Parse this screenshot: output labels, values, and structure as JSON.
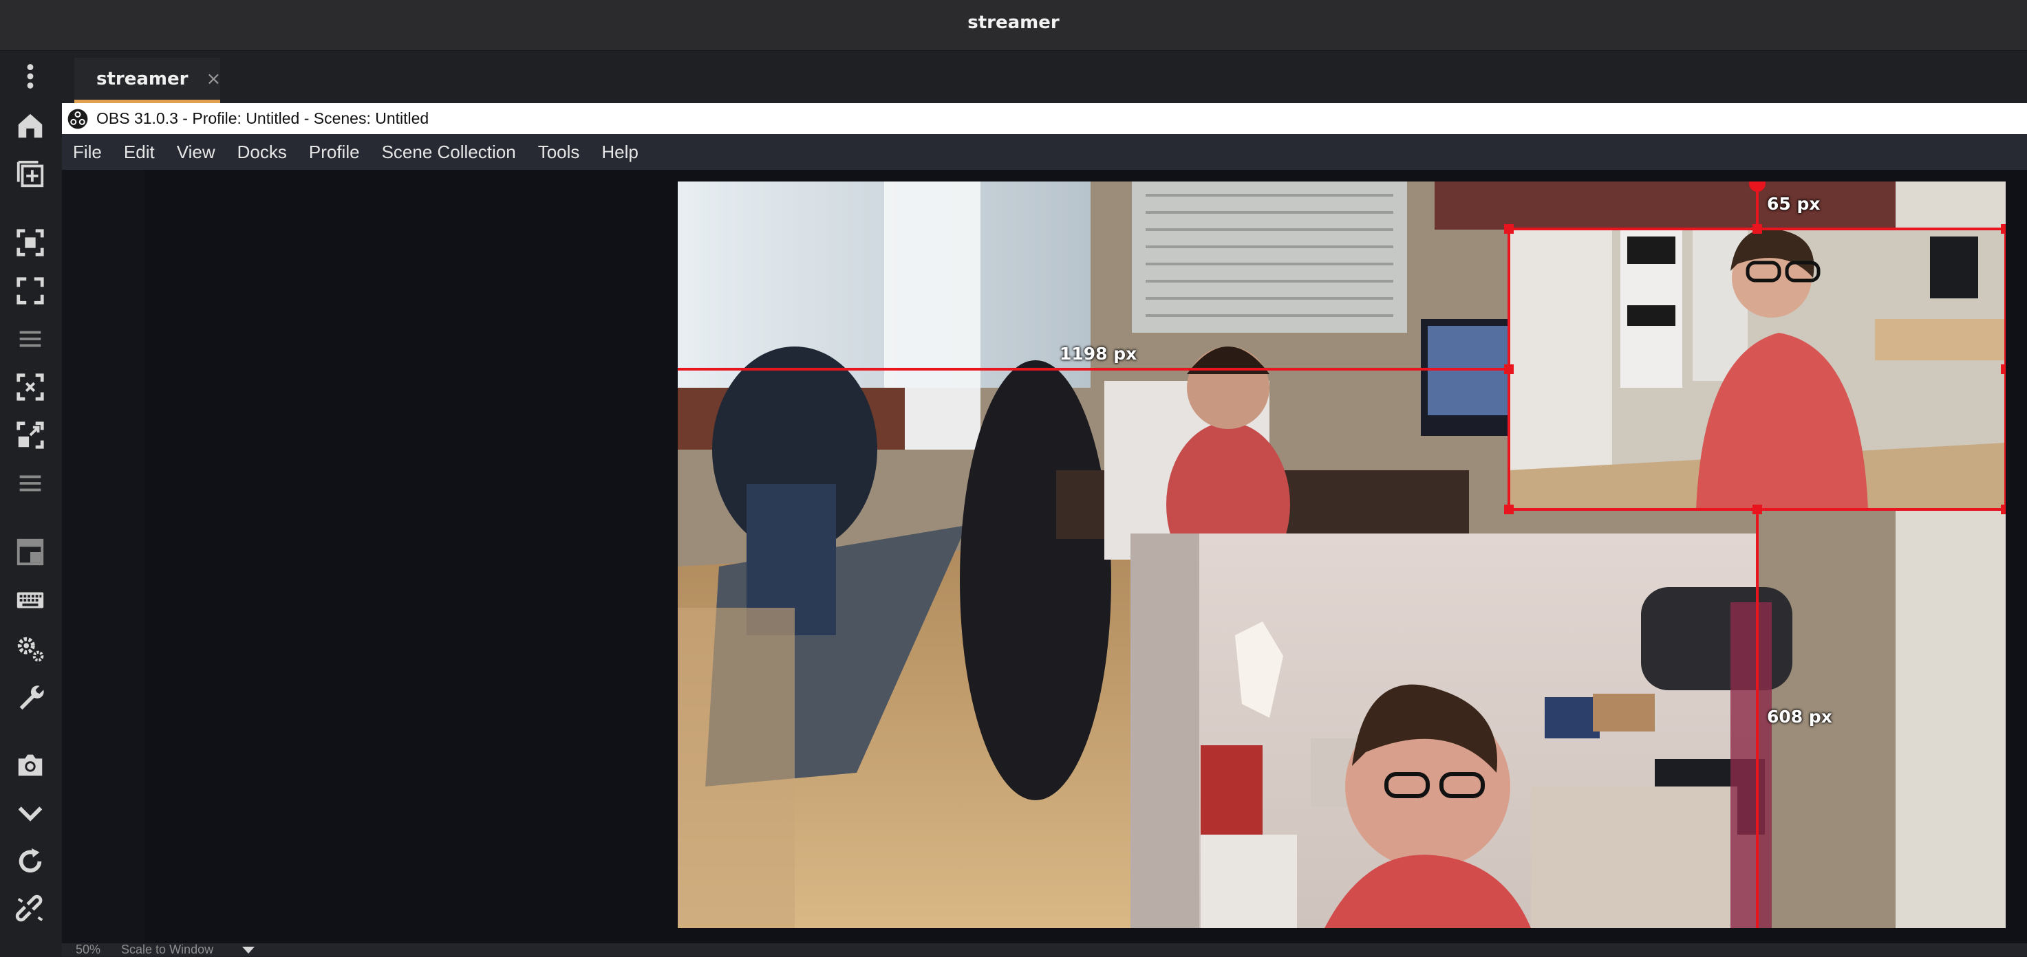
{
  "window": {
    "title": "streamer"
  },
  "tab": {
    "label": "streamer",
    "close": "×"
  },
  "obs": {
    "title": "OBS 31.0.3 - Profile: Untitled - Scenes: Untitled"
  },
  "menu": [
    "File",
    "Edit",
    "View",
    "Docks",
    "Profile",
    "Scene Collection",
    "Tools",
    "Help"
  ],
  "preview": {
    "guides": {
      "left_distance": "1198 px",
      "top_distance": "65 px",
      "bottom_distance": "608 px"
    }
  },
  "status": {
    "zoom": "50%",
    "scale_mode": "Scale to Window"
  },
  "colors": {
    "accent": "#e0a050",
    "selection": "#e8141e",
    "menubar": "#272a33",
    "workspace": "#0f1116"
  },
  "rail_icons": [
    "more-vertical-icon",
    "home-icon",
    "add-box-icon",
    "focus-icon",
    "fullscreen-icon",
    "menu-lines-icon",
    "scale-in-icon",
    "scale-out-icon",
    "menu-lines-icon",
    "layout-icon",
    "keyboard-icon",
    "settings-icon",
    "wrench-icon",
    "camera-icon",
    "chevron-down-icon",
    "refresh-icon",
    "link-break-icon"
  ]
}
